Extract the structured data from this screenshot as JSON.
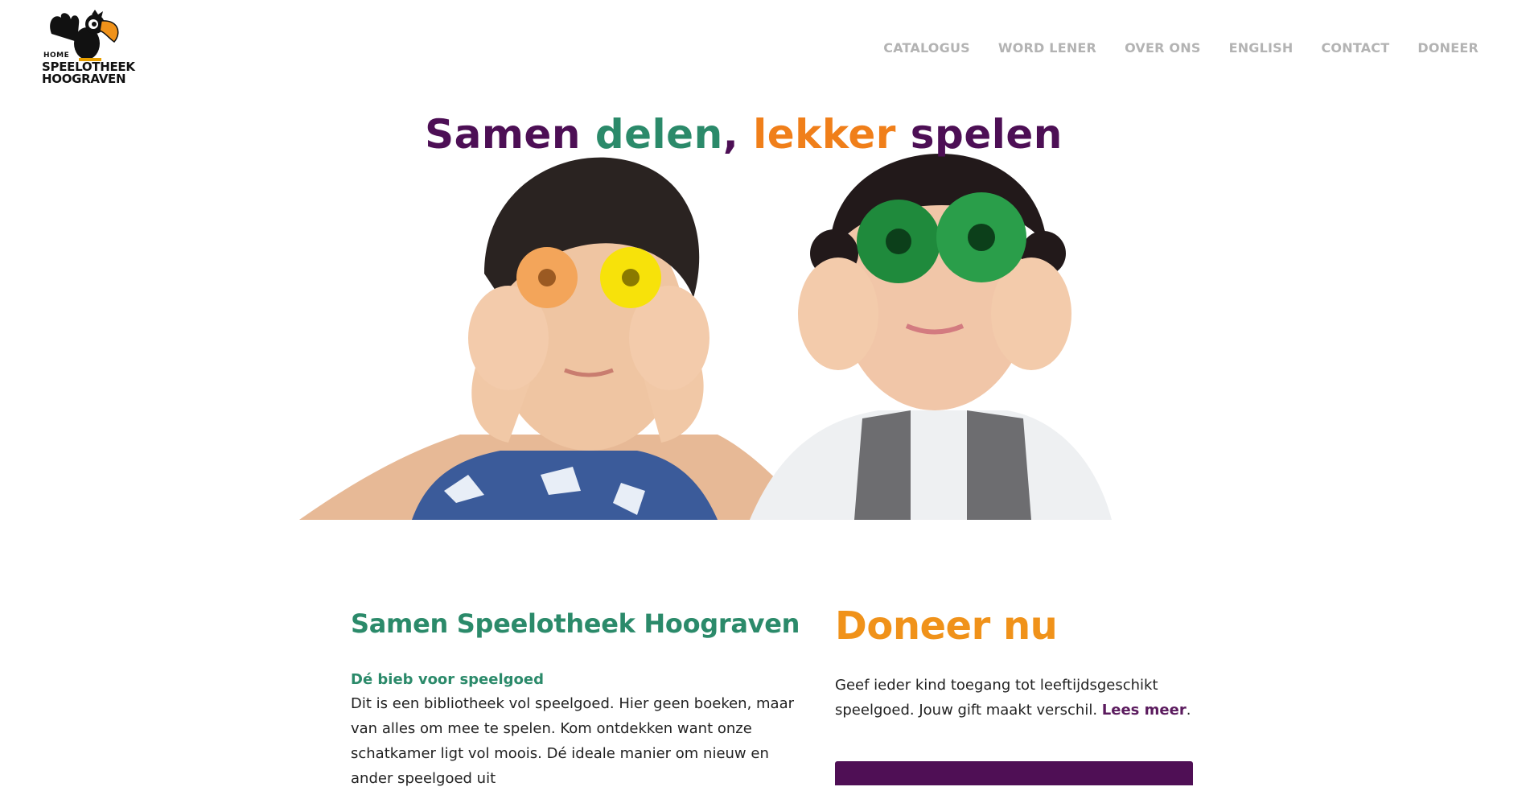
{
  "header": {
    "logo": {
      "home_label": "HOME",
      "line1": "SPEELOTHEEK",
      "line2": "HOOGRAVEN"
    },
    "nav": [
      {
        "label": "CATALOGUS"
      },
      {
        "label": "WORD LENER"
      },
      {
        "label": "OVER ONS"
      },
      {
        "label": "ENGLISH"
      },
      {
        "label": "CONTACT"
      },
      {
        "label": "DONEER"
      }
    ]
  },
  "hero": {
    "title_parts": [
      {
        "text": "Samen ",
        "color": "#4d0f55"
      },
      {
        "text": "delen",
        "color": "#2b8a6a"
      },
      {
        "text": ", ",
        "color": "#4d0f55"
      },
      {
        "text": "lekker ",
        "color": "#f07f1a"
      },
      {
        "text": "spelen",
        "color": "#4d0f55"
      }
    ]
  },
  "intro": {
    "title": "Samen Speelotheek Hoograven",
    "subtitle": "Dé bieb voor speelgoed",
    "text": "Dit is een bibliotheek vol speelgoed. Hier geen boeken, maar van alles om mee te spelen. Kom ontdekken want onze schatkamer ligt vol moois. Dé ideale manier om nieuw en ander speelgoed uit"
  },
  "donate": {
    "title": "Doneer nu",
    "text": "Geef ieder kind toegang tot leeftijdsgeschikt speelgoed. Jouw gift maakt verschil. ",
    "link_label": "Lees meer",
    "suffix": "."
  },
  "colors": {
    "green": "#2b8a6a",
    "orange": "#f0921a",
    "purple": "#4f0f55",
    "nav_gray": "#b3b3b3"
  }
}
